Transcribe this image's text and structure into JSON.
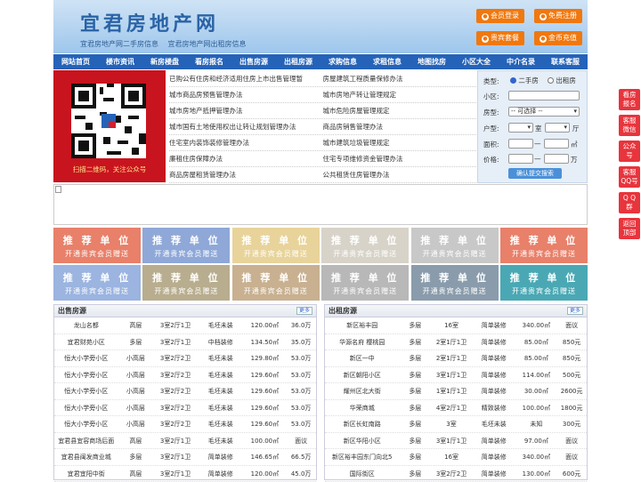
{
  "header": {
    "logo": "宜君房地产网",
    "link1": "宜君房地产网二手房信息",
    "link2": "宜君房地产网出租房信息",
    "btn_login": "会员登录",
    "btn_register": "免费注册",
    "btn_package": "贵宾套餐",
    "btn_recharge": "金币充值"
  },
  "nav": [
    "网站首页",
    "楼市资讯",
    "新房楼盘",
    "看房报名",
    "出售房源",
    "出租房源",
    "求购信息",
    "求租信息",
    "地图找房",
    "小区大全",
    "中介名录",
    "联系客服"
  ],
  "qr": {
    "caption": "扫描二维码，关注公众号"
  },
  "news": [
    [
      "已购公有住房和经济适用住房上市出售管理暂",
      "房屋建筑工程质量保修办法"
    ],
    [
      "城市商品房预售管理办法",
      "城市房地产转让管理规定"
    ],
    [
      "城市房地产抵押管理办法",
      "城市危险房屋管理规定"
    ],
    [
      "城市国有土地使用权出让转让规划管理办法",
      "商品房销售管理办法"
    ],
    [
      "住宅室内装饰装修管理办法",
      "城市建筑垃圾管理规定"
    ],
    [
      "廉租住房保障办法",
      "住宅专项维修资金管理办法"
    ],
    [
      "商品房屋租赁管理办法",
      "公共租赁住房管理办法"
    ]
  ],
  "search": {
    "type_label": "类型:",
    "opt_sale": "二手房",
    "opt_rent": "出租房",
    "community_label": "小区:",
    "house_type_label": "房型:",
    "house_type_value": "-- 可选择 --",
    "layout_label": "户型:",
    "room": "室",
    "hall": "厅",
    "area_label": "面积:",
    "area_unit": "㎡",
    "area_sep": "—",
    "price_label": "价格:",
    "price_unit": "万",
    "price_sep": "—",
    "submit": "确认提交搜索"
  },
  "ads": {
    "line1": "推 荐 单 位",
    "line2": "开通贵宾会员赠送",
    "colors_row1": [
      "#e8806a",
      "#8fa8d8",
      "#e8d39a",
      "#d8d3c8",
      "#c8c8c8",
      "#e8806a"
    ],
    "colors_row2": [
      "#9bb4e0",
      "#b8ad8e",
      "#c8b090",
      "#b8b8b8",
      "#8a9cac",
      "#4aa8b4"
    ]
  },
  "sale": {
    "title": "出售房源",
    "more": "更多",
    "rows": [
      [
        "龙山名都",
        "高层",
        "3室2厅1卫",
        "毛坯未装",
        "120.00㎡",
        "36.0万"
      ],
      [
        "宜君财苑小区",
        "多层",
        "3室2厅1卫",
        "中档装修",
        "134.50㎡",
        "35.0万"
      ],
      [
        "恒大小学旁小区",
        "小高层",
        "3室2厅2卫",
        "毛坯未装",
        "129.80㎡",
        "53.0万"
      ],
      [
        "恒大小学旁小区",
        "小高层",
        "3室2厅2卫",
        "毛坯未装",
        "129.60㎡",
        "53.0万"
      ],
      [
        "恒大小学旁小区",
        "小高层",
        "3室2厅2卫",
        "毛坯未装",
        "129.60㎡",
        "53.0万"
      ],
      [
        "恒大小学旁小区",
        "小高层",
        "3室2厅2卫",
        "毛坯未装",
        "129.60㎡",
        "53.0万"
      ],
      [
        "恒大小学旁小区",
        "小高层",
        "3室2厅2卫",
        "毛坯未装",
        "129.60㎡",
        "53.0万"
      ],
      [
        "宜君县宜容商场后面",
        "高层",
        "3室2厅1卫",
        "毛坯未装",
        "100.00㎡",
        "面议"
      ],
      [
        "宜君县闽发商业城",
        "多层",
        "3室2厅1卫",
        "简单装修",
        "146.65㎡",
        "66.5万"
      ],
      [
        "宜君宜阳中街",
        "高层",
        "3室2厅1卫",
        "简单装修",
        "120.00㎡",
        "45.0万"
      ]
    ]
  },
  "rent": {
    "title": "出租房源",
    "more": "更多",
    "rows": [
      [
        "新区裕丰园",
        "多层",
        "16室",
        "简单装修",
        "340.00㎡",
        "面议"
      ],
      [
        "华源名府 樱桃园",
        "多层",
        "2室1厅1卫",
        "简单装修",
        "85.00㎡",
        "850元"
      ],
      [
        "新区一中",
        "多层",
        "2室1厅1卫",
        "简单装修",
        "85.00㎡",
        "850元"
      ],
      [
        "新区朝阳小区",
        "多层",
        "3室1厅1卫",
        "简单装修",
        "114.00㎡",
        "500元"
      ],
      [
        "耀州区北大街",
        "多层",
        "1室1厅1卫",
        "简单装修",
        "30.00㎡",
        "2600元"
      ],
      [
        "华荣商城",
        "多层",
        "4室2厅1卫",
        "精致装修",
        "100.00㎡",
        "1800元"
      ],
      [
        "新区长虹南路",
        "多层",
        "3室",
        "毛坯未装",
        "未知",
        "300元"
      ],
      [
        "新区华阳小区",
        "多层",
        "3室1厅1卫",
        "简单装修",
        "97.00㎡",
        "面议"
      ],
      [
        "新区裕丰园东门向北5",
        "多层",
        "16室",
        "简单装修",
        "340.00㎡",
        "面议"
      ],
      [
        "国际街区",
        "多层",
        "3室2厅2卫",
        "简单装修",
        "130.00㎡",
        "600元"
      ]
    ]
  },
  "side": [
    [
      "看房",
      "报名"
    ],
    [
      "客服",
      "微信"
    ],
    [
      "公众",
      "号"
    ],
    [
      "客服",
      "QQ号"
    ],
    [
      "Q Q",
      "群"
    ],
    [
      "返回",
      "顶部"
    ]
  ]
}
